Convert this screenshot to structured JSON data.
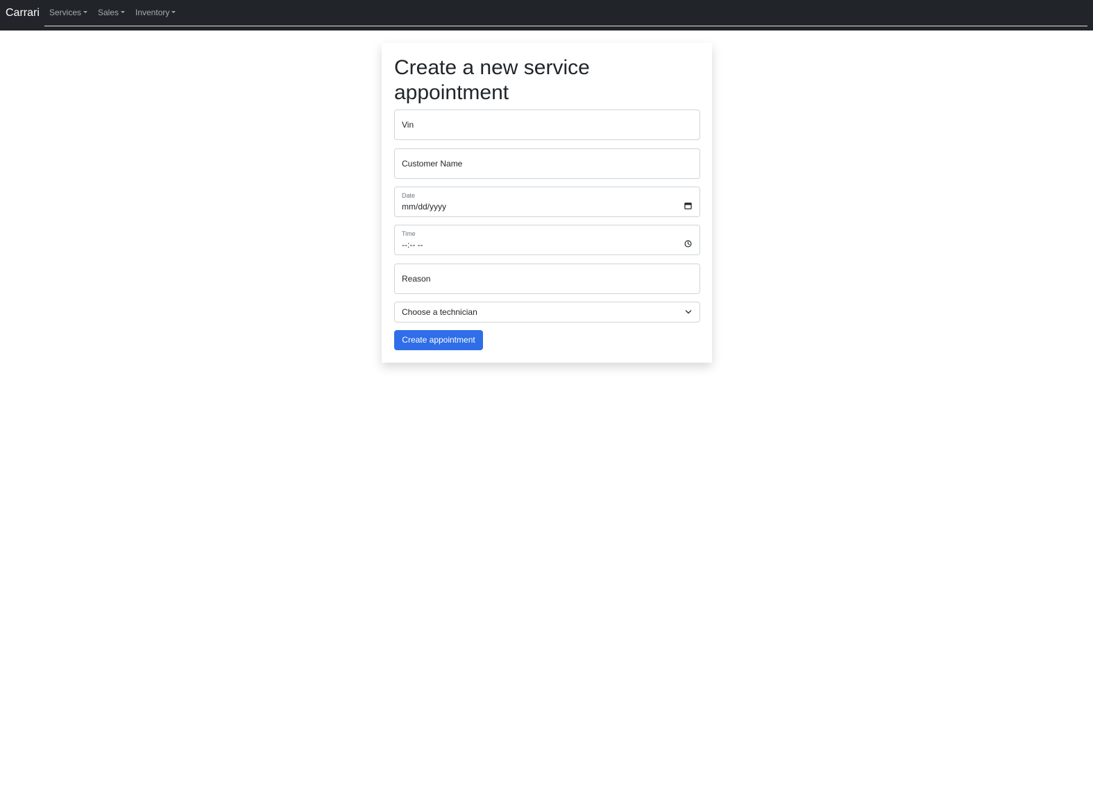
{
  "navbar": {
    "brand": "Carrari",
    "items": [
      {
        "label": "Services",
        "icon": "caret-down-icon"
      },
      {
        "label": "Sales",
        "icon": "caret-down-icon"
      },
      {
        "label": "Inventory",
        "icon": "caret-down-icon"
      }
    ]
  },
  "form": {
    "title": "Create a new service appointment",
    "vin": {
      "placeholder": "Vin",
      "value": ""
    },
    "customer_name": {
      "placeholder": "Customer Name",
      "value": ""
    },
    "date": {
      "label": "Date",
      "value": "mm/dd/yyyy",
      "icon": "calendar-icon"
    },
    "time": {
      "label": "Time",
      "value": "--:-- --",
      "icon": "clock-icon"
    },
    "reason": {
      "placeholder": "Reason",
      "value": ""
    },
    "technician": {
      "selected": "Choose a technician",
      "icon": "chevron-down-icon"
    },
    "submit_label": "Create appointment"
  },
  "colors": {
    "navbar_bg": "#212529",
    "primary": "#2f6ee8"
  }
}
